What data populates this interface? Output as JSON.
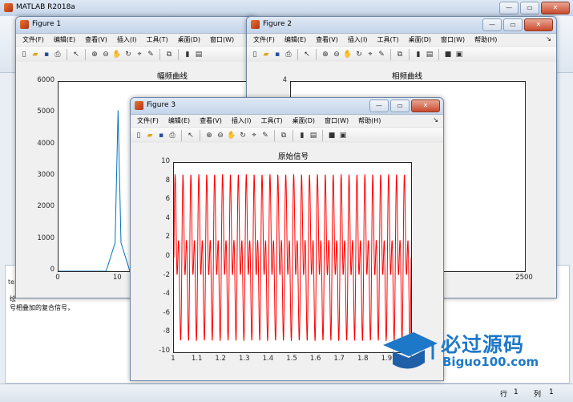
{
  "matlab": {
    "title": "MATLAB R2018a",
    "bg_text_1": "绘",
    "bg_text_2": "号相叠加的复合信号，",
    "bg_text_3": "te",
    "status_row_label": "行",
    "status_row_value": "1",
    "status_col_label": "列",
    "status_col_value": "1"
  },
  "menu": [
    "文件(F)",
    "编辑(E)",
    "查看(V)",
    "插入(I)",
    "工具(T)",
    "桌面(D)",
    "窗口(W)",
    "帮助(H)"
  ],
  "window_buttons": {
    "minimize": "—",
    "maximize": "▭",
    "close": "✕"
  },
  "figure1": {
    "title": "Figure 1",
    "plot_title": "幅频曲线",
    "yticks": [
      "6000",
      "5000",
      "4000",
      "3000",
      "2000",
      "1000",
      "0"
    ],
    "xticks": [
      "0",
      "10",
      "20",
      "30"
    ],
    "color": "#0072bd"
  },
  "figure2": {
    "title": "Figure 2",
    "plot_title": "相频曲线",
    "yticks": [
      "4"
    ],
    "xticks": [
      "2000",
      "2500"
    ],
    "color": "#0072bd"
  },
  "figure3": {
    "title": "Figure 3",
    "plot_title": "原始信号",
    "yticks": [
      "10",
      "8",
      "6",
      "4",
      "2",
      "0",
      "-2",
      "-4",
      "-6",
      "-8",
      "-10"
    ],
    "xticks": [
      "1",
      "1.1",
      "1.2",
      "1.3",
      "1.4",
      "1.5",
      "1.6",
      "1.7",
      "1.8",
      "1.9",
      "2"
    ],
    "color": "#ff0000"
  },
  "chart_data": [
    {
      "type": "line",
      "title": "幅频曲线",
      "xlim": [
        0,
        35
      ],
      "ylim": [
        0,
        6000
      ],
      "x": [
        0,
        8,
        9.5,
        10,
        10.5,
        12,
        35
      ],
      "series": [
        {
          "values": [
            0,
            0,
            900,
            5100,
            900,
            0,
            0
          ]
        }
      ]
    },
    {
      "type": "line",
      "title": "相频曲线",
      "xlim": [
        1600,
        2500
      ],
      "ylim": [
        0,
        4
      ],
      "x": [
        1600,
        2020,
        2020,
        2030,
        2030
      ],
      "series": [
        {
          "values": [
            0.3,
            0.6,
            1.6,
            1.6,
            0.6
          ]
        }
      ]
    },
    {
      "type": "line",
      "title": "原始信号",
      "xlim": [
        1,
        2
      ],
      "ylim": [
        -10,
        10
      ],
      "signal": "5*sin(2*pi*30*t) + 5*sin(2*pi*60*t)",
      "series": [
        {
          "values": []
        }
      ]
    }
  ],
  "logo": {
    "cn": "必过源码",
    "en": "Biguo100.com"
  }
}
